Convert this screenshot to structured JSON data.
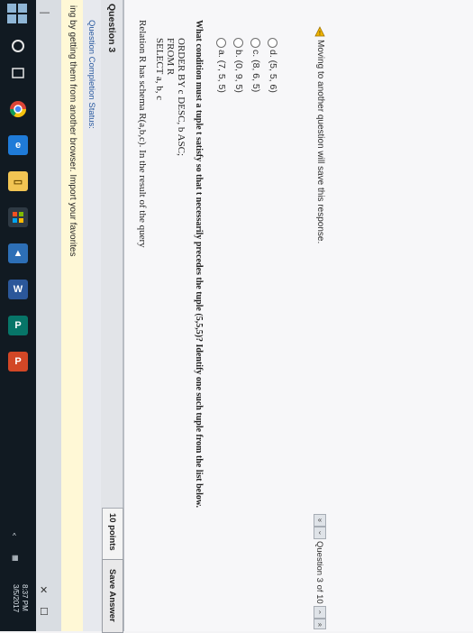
{
  "browser": {
    "import_banner": "ing by getting them from another browser. Import your favorites",
    "window_controls": [
      "☐",
      "✕",
      "—",
      "▭"
    ]
  },
  "status": {
    "question_status_label": "Question Completion Status:"
  },
  "question": {
    "number_label": "Question 3",
    "points": "10 points",
    "save_label": "Save Answer",
    "prompt": "Relation R has schema R(a,b,c). In the result of the query",
    "query_lines": [
      "SELECT a, b, c",
      "FROM R",
      "ORDER BY c DESC, b ASC;"
    ],
    "instruction": "What condition must a tuple t satisfy so that t necessarily precedes the tuple (5,5,5)? Identify one such tuple from the list below.",
    "options": [
      {
        "label": "a. (7, 5, 5)"
      },
      {
        "label": "b. (0, 9, 5)"
      },
      {
        "label": "c. (8, 6, 5)"
      },
      {
        "label": "d. (5, 5, 6)"
      }
    ]
  },
  "footer": {
    "warning": "Moving to another question will save this response.",
    "pager": "Question 3 of 10"
  },
  "taskbar": {
    "time": "8:37 PM",
    "date": "3/5/2017",
    "icons": [
      "start-icon",
      "cortana-icon",
      "task-view-icon",
      "chrome-icon",
      "edge-icon",
      "file-explorer-icon",
      "store-icon",
      "photos-icon",
      "word-icon",
      "publisher-icon",
      "powerpoint-icon"
    ]
  }
}
